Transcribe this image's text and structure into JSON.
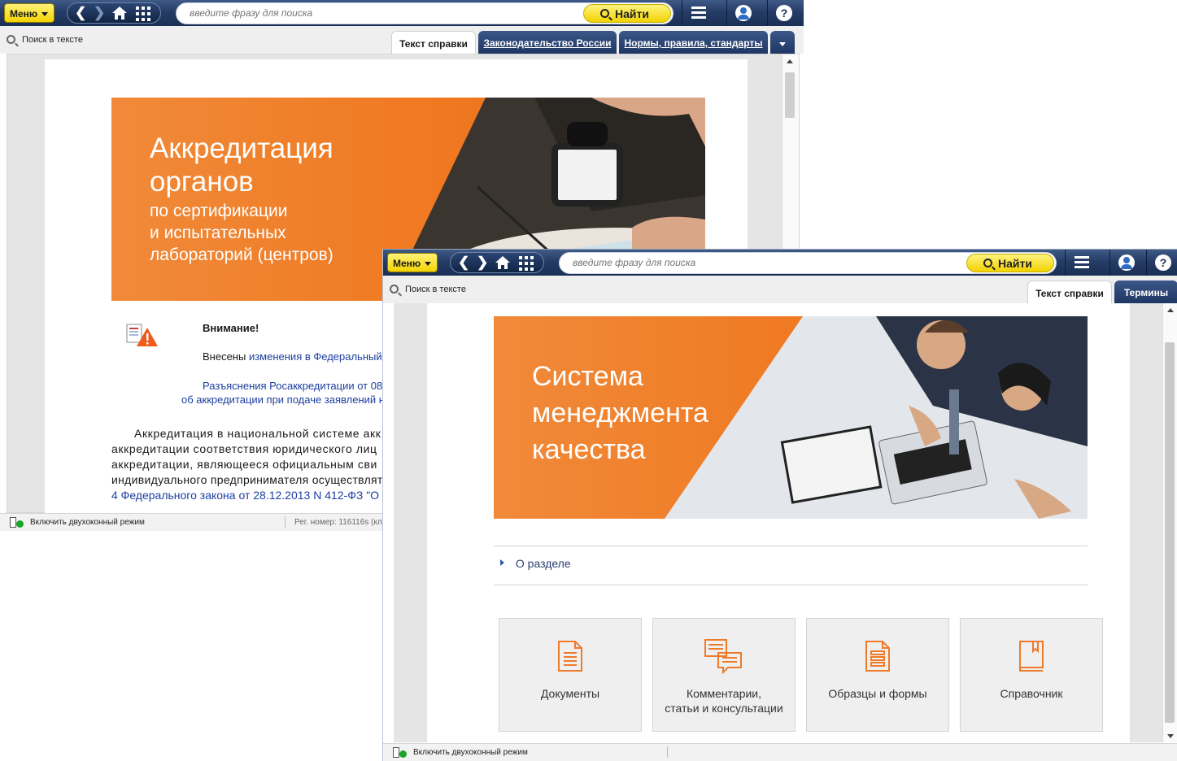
{
  "window_back": {
    "toolbar": {
      "menu_label": "Меню",
      "search_placeholder": "введите фразу для поиска",
      "find_label": "Найти"
    },
    "find_in_text": "Поиск в тексте",
    "tabs": [
      {
        "label": "Текст справки",
        "active": true
      },
      {
        "label": "Законодательство России",
        "active": false
      },
      {
        "label": "Нормы, правила, стандарты",
        "active": false
      }
    ],
    "banner": {
      "title_lines": [
        "Аккредитация",
        "органов"
      ],
      "subtitle_lines": [
        "по сертификации",
        "и испытательных",
        "лабораторий (центров)"
      ]
    },
    "notice": {
      "heading": "Внимание!",
      "line1_prefix": "Внесены ",
      "line1_link": "изменения",
      "line1_suffix": " в Федеральный з",
      "line2": "Разъяснения Росаккредитации от 08",
      "line3": "об аккредитации при подаче заявлений на"
    },
    "body_lines": [
      "Аккредитация в национальной системе акк",
      "аккредитации соответствия юридического лиц",
      "аккредитации, являющееся официальным сви",
      "индивидуального предпринимателя осуществлят"
    ],
    "body_link": "4 Федерального закона от 28.12.2013 N 412-ФЗ \"О",
    "status": {
      "dual_mode": "Включить двухоконный режим",
      "reg_number": "Рег. номер: 116116s (кл"
    }
  },
  "window_front": {
    "toolbar": {
      "menu_label": "Меню",
      "search_placeholder": "введите фразу для поиска",
      "find_label": "Найти"
    },
    "find_in_text": "Поиск в тексте",
    "tabs": [
      {
        "label": "Текст справки",
        "active": true
      },
      {
        "label": "Термины",
        "active": false
      }
    ],
    "banner": {
      "title_lines": [
        "Система",
        "менеджмента",
        "качества"
      ]
    },
    "about_label": "О разделе",
    "tiles": [
      {
        "label": "Документы",
        "icon": "document-icon"
      },
      {
        "label": "Комментарии, статьи и консультации",
        "icon": "comments-icon"
      },
      {
        "label": "Образцы и формы",
        "icon": "forms-icon"
      },
      {
        "label": "Справочник",
        "icon": "book-icon"
      }
    ],
    "status": {
      "dual_mode": "Включить двухоконный режим"
    }
  },
  "colors": {
    "toolbar": "#1f3663",
    "accent_yellow": "#f3d400",
    "banner_orange": "#f07a22",
    "icon_orange": "#ef7a2a",
    "link": "#1c3ea0"
  }
}
